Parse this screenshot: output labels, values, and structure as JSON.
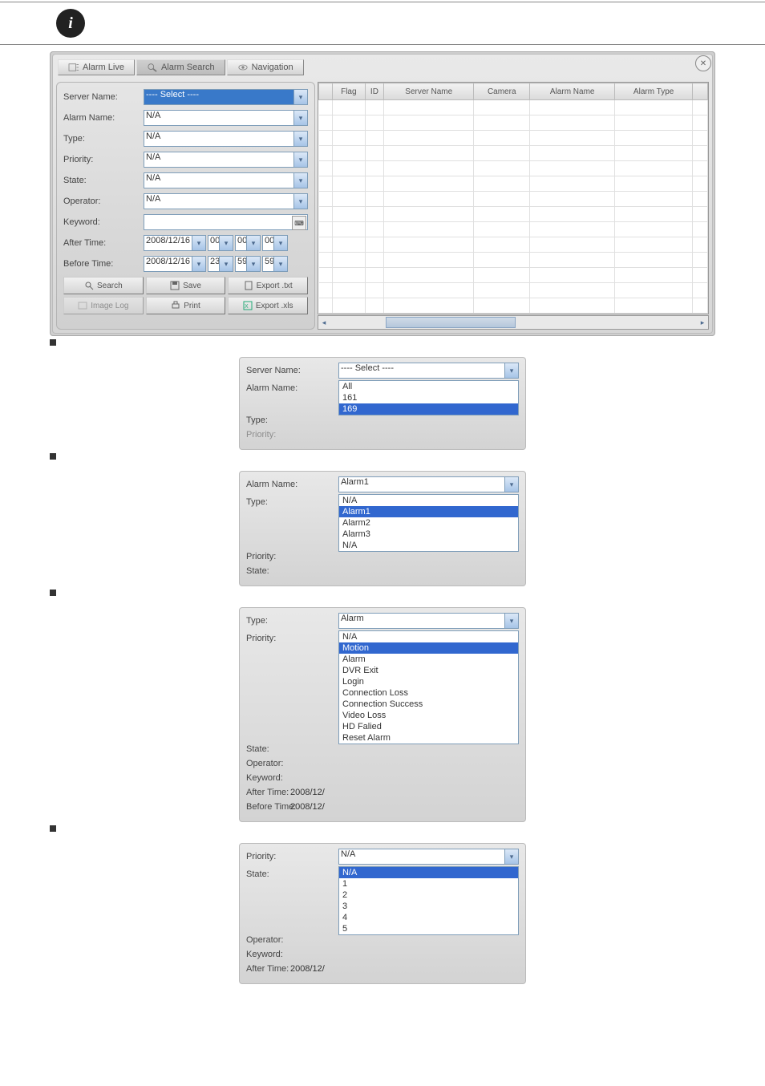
{
  "tabs": {
    "live": "Alarm Live",
    "search": "Alarm Search",
    "nav": "Navigation"
  },
  "form": {
    "server_name": "Server Name:",
    "alarm_name": "Alarm Name:",
    "type": "Type:",
    "priority": "Priority:",
    "state": "State:",
    "operator": "Operator:",
    "keyword": "Keyword:",
    "after_time": "After Time:",
    "before_time": "Before Time:",
    "select_placeholder": "----  Select  ----",
    "na": "N/A",
    "date": "2008/12/16",
    "h0": "00",
    "m0": "00",
    "s0": "00",
    "h1": "23",
    "m1": "59",
    "s1": "59"
  },
  "buttons": {
    "search": "Search",
    "save": "Save",
    "export_txt": "Export .txt",
    "image_log": "Image Log",
    "print": "Print",
    "export_xls": "Export .xls"
  },
  "grid_headers": [
    "Flag",
    "ID",
    "Server Name",
    "Camera",
    "Alarm Name",
    "Alarm Type"
  ],
  "ex1": {
    "server_name": "Server Name:",
    "alarm_name": "Alarm Name:",
    "type": "Type:",
    "priority": "Priority:",
    "select": "----  Select  ----",
    "all": "All",
    "o1": "161",
    "o2": "169"
  },
  "ex2": {
    "alarm_name": "Alarm Name:",
    "type": "Type:",
    "priority": "Priority:",
    "state": "State:",
    "val": "Alarm1",
    "opts": [
      "N/A",
      "Alarm1",
      "Alarm2",
      "Alarm3",
      "N/A"
    ]
  },
  "ex3": {
    "type": "Type:",
    "priority": "Priority:",
    "state": "State:",
    "operator": "Operator:",
    "keyword": "Keyword:",
    "after_time": "After Time:",
    "before_time": "Before Time:",
    "val": "Alarm",
    "date_prefix": "2008/12/",
    "opts": [
      "N/A",
      "Motion",
      "Alarm",
      "DVR Exit",
      "Login",
      "Connection Loss",
      "Connection Success",
      "Video Loss",
      "HD Falied",
      "Reset Alarm"
    ]
  },
  "ex4": {
    "priority": "Priority:",
    "state": "State:",
    "operator": "Operator:",
    "keyword": "Keyword:",
    "after_time": "After Time:",
    "val": "N/A",
    "date_prefix": "2008/12/",
    "opts": [
      "N/A",
      "1",
      "2",
      "3",
      "4",
      "5"
    ]
  }
}
